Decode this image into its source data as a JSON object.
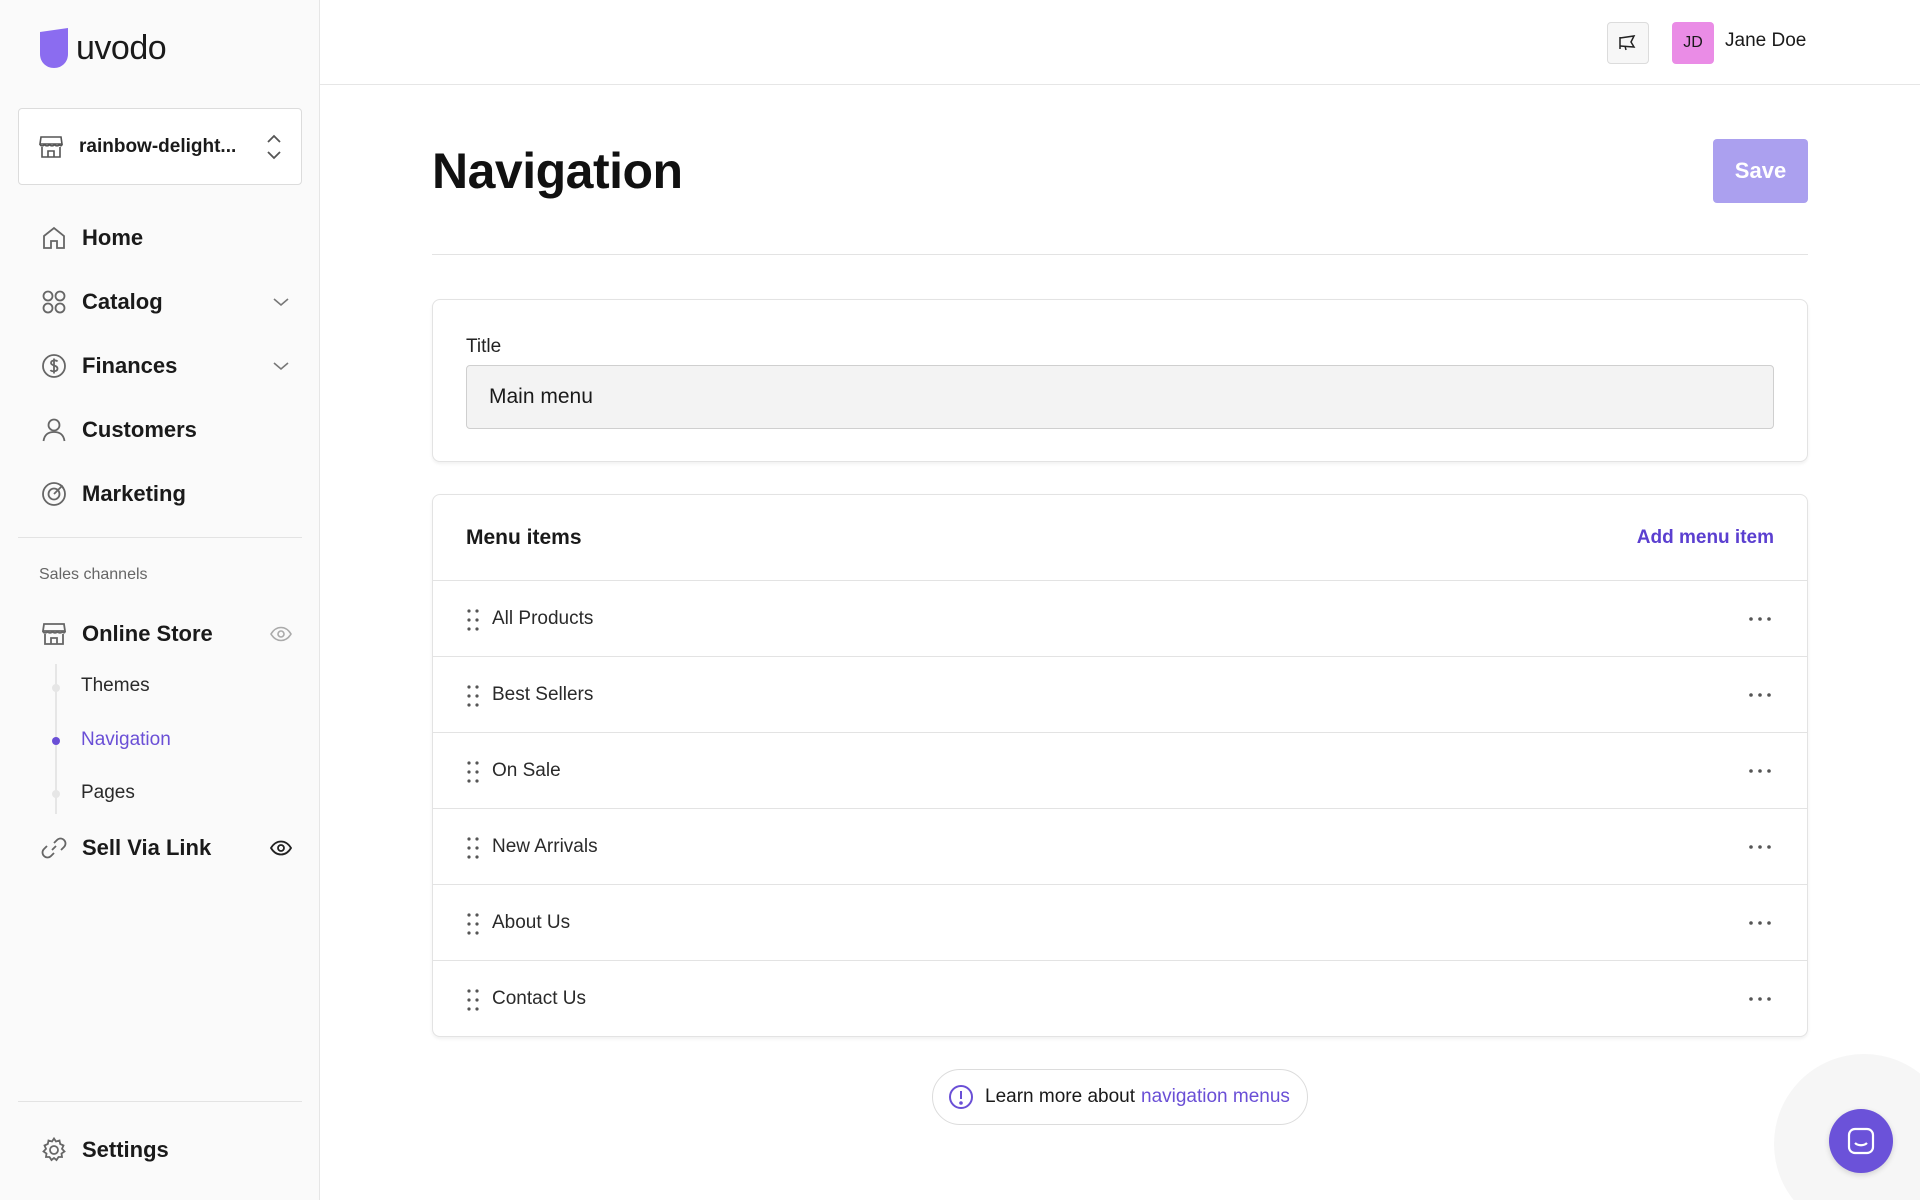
{
  "app": {
    "logo_text": "uvodo"
  },
  "store_switcher": {
    "name": "rainbow-delight..."
  },
  "sidebar": {
    "items": [
      {
        "label": "Home",
        "icon": "home-icon"
      },
      {
        "label": "Catalog",
        "icon": "grid-icon",
        "expandable": true
      },
      {
        "label": "Finances",
        "icon": "dollar-icon",
        "expandable": true
      },
      {
        "label": "Customers",
        "icon": "user-icon"
      },
      {
        "label": "Marketing",
        "icon": "target-icon"
      }
    ],
    "sales_channels_label": "Sales channels",
    "channels": [
      {
        "label": "Online Store",
        "icon": "store-icon",
        "visibility": "hidden-eye"
      },
      {
        "label": "Sell Via Link",
        "icon": "link-icon",
        "visibility": "visible-eye"
      }
    ],
    "online_store_sub": [
      {
        "label": "Themes",
        "active": false
      },
      {
        "label": "Navigation",
        "active": true
      },
      {
        "label": "Pages",
        "active": false
      }
    ],
    "settings_label": "Settings"
  },
  "topbar": {
    "user_initials": "JD",
    "user_name": "Jane Doe"
  },
  "page": {
    "title": "Navigation",
    "save_label": "Save"
  },
  "title_card": {
    "label": "Title",
    "value": "Main menu"
  },
  "menu_card": {
    "title": "Menu items",
    "add_label": "Add menu item",
    "items": [
      "All Products",
      "Best Sellers",
      "On Sale",
      "New Arrivals",
      "About Us",
      "Contact Us"
    ]
  },
  "learn_more": {
    "prefix": "Learn more about",
    "link": "navigation menus"
  },
  "colors": {
    "accent": "#6a4fd6",
    "save_disabled": "#aba0ef",
    "avatar_bg": "#ea8ce6",
    "logo": "#8b6cf0"
  }
}
